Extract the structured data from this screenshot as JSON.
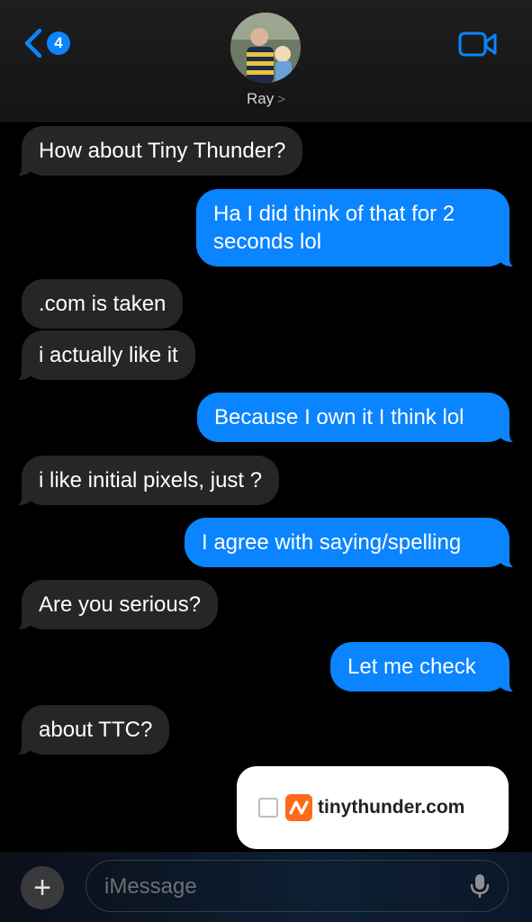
{
  "header": {
    "unread_count": "4",
    "contact_name": "Ray",
    "contact_chevron": ">"
  },
  "messages": [
    {
      "side": "in",
      "text": "How about Tiny Thunder?"
    },
    {
      "side": "out",
      "text": "Ha I did think of that for 2 seconds lol"
    },
    {
      "side": "in",
      "text": ".com is taken"
    },
    {
      "side": "in",
      "text": "i actually like it"
    },
    {
      "side": "out",
      "text": "Because I own it I think lol"
    },
    {
      "side": "in",
      "text": "i like initial pixels, just ?"
    },
    {
      "side": "out",
      "text": "I agree with saying/spelling"
    },
    {
      "side": "in",
      "text": "Are you serious?"
    },
    {
      "side": "out",
      "text": "Let me check"
    },
    {
      "side": "in",
      "text": "about TTC?"
    }
  ],
  "link_card": {
    "site": "tinythunder.com"
  },
  "composer": {
    "placeholder": "iMessage",
    "add_label": "+"
  },
  "colors": {
    "accent": "#0a84ff",
    "incoming_bubble": "#262628",
    "brand_logo": "#ff6a1a"
  },
  "icons": [
    "back-chevron-icon",
    "video-camera-icon",
    "microphone-icon",
    "plus-icon"
  ]
}
